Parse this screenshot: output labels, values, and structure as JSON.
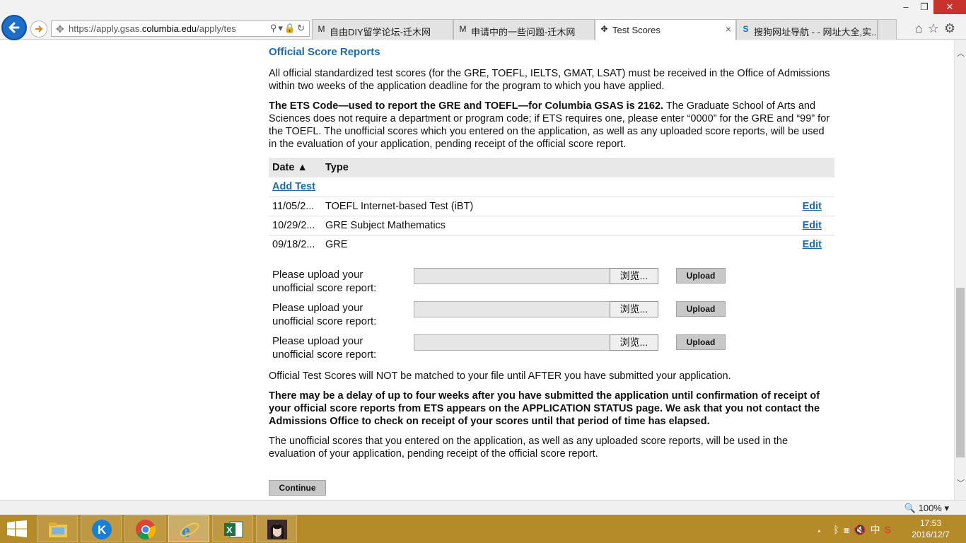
{
  "browser": {
    "url_prefix": "https://apply.gsas.",
    "url_domain": "columbia.edu",
    "url_suffix": "/apply/tes",
    "tabs": [
      {
        "label": "自由DIY留学论坛-迁木网",
        "icon": "M"
      },
      {
        "label": "申请中的一些问题-迁木网",
        "icon": "M"
      },
      {
        "label": "Test Scores",
        "icon": "✥",
        "close": "×"
      },
      {
        "label": "搜狗网址导航 - - 网址大全,实...",
        "icon": "S"
      }
    ],
    "zoom": "100%"
  },
  "page": {
    "heading": "Official Score Reports",
    "intro": "All official standardized test scores (for the GRE, TOEFL, IELTS, GMAT, LSAT) must be received in the Office of Admissions within two weeks of the application deadline for the program to which you have applied.",
    "ets_bold": "The ETS Code—used to report the GRE and TOEFL—for Columbia GSAS is 2162.",
    "ets_rest": " The Graduate School of Arts and Sciences does not require a department or program code; if ETS requires one, please enter “0000” for the GRE and “99” for the TOEFL. The unofficial scores which you entered on the application, as well as any uploaded score reports, will be used in the evaluation of your application, pending receipt of the official score report.",
    "table": {
      "col_date": "Date ▲",
      "col_type": "Type",
      "add_test": "Add Test",
      "rows": [
        {
          "date": "11/05/2...",
          "type": "TOEFL Internet-based Test (iBT)",
          "edit": "Edit"
        },
        {
          "date": "10/29/2...",
          "type": "GRE Subject Mathematics",
          "edit": "Edit"
        },
        {
          "date": "09/18/2...",
          "type": "GRE",
          "edit": "Edit"
        }
      ]
    },
    "uploads": [
      {
        "label": "Please upload your unofficial score report:",
        "browse": "浏览...",
        "upload": "Upload"
      },
      {
        "label": "Please upload your unofficial score report:",
        "browse": "浏览...",
        "upload": "Upload"
      },
      {
        "label": "Please upload your unofficial score report:",
        "browse": "浏览...",
        "upload": "Upload"
      }
    ],
    "not_matched": "Official Test Scores will NOT be matched to your file until AFTER you have submitted your application.",
    "delay_warning": "There may be a delay of up to four weeks after you have submitted the application until confirmation of receipt of your official score reports from ETS appears on the APPLICATION STATUS page. We ask that you not contact the Admissions Office to check on receipt of your scores until that period of time has elapsed.",
    "unofficial_note": "The unofficial scores that you entered on the application, as well as any uploaded score reports, will be used in the evaluation of your application, pending receipt of the official score report.",
    "continue": "Continue"
  },
  "taskbar": {
    "time": "17:53",
    "date": "2016/12/7",
    "ime": "中"
  }
}
